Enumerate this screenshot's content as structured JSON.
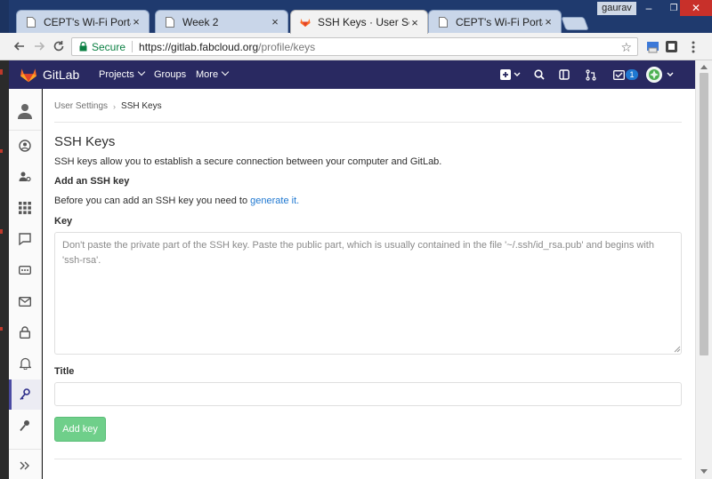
{
  "browser": {
    "tabs": [
      {
        "title": "CEPT's Wi-Fi Portal",
        "active": false
      },
      {
        "title": "Week 2",
        "active": false
      },
      {
        "title": "SSH Keys · User Settings",
        "active": true
      },
      {
        "title": "CEPT's Wi-Fi Portal",
        "active": false
      }
    ],
    "user_badge": "gaurav",
    "window_controls": [
      "–",
      "❐",
      "✕"
    ],
    "secure_label": "Secure",
    "url_host": "https://gitlab.fabcloud.org",
    "url_path": "/profile/keys"
  },
  "header": {
    "brand": "GitLab",
    "nav": [
      {
        "label": "Projects"
      },
      {
        "label": "Groups"
      },
      {
        "label": "More"
      }
    ],
    "todo_count": "1",
    "colors": {
      "background": "#292961",
      "accent": "#fc6d26"
    }
  },
  "sidebar": {
    "items": [
      {
        "icon": "profile-avatar-icon"
      },
      {
        "icon": "user-circle-icon"
      },
      {
        "icon": "account-icon"
      },
      {
        "icon": "applications-icon"
      },
      {
        "icon": "chat-icon"
      },
      {
        "icon": "tokens-icon"
      },
      {
        "icon": "emails-icon"
      },
      {
        "icon": "password-lock-icon"
      },
      {
        "icon": "notifications-bell-icon"
      },
      {
        "icon": "ssh-key-icon",
        "active": true
      },
      {
        "icon": "gpg-key-icon"
      },
      {
        "icon": "collapse-sidebar-icon"
      }
    ]
  },
  "breadcrumb": {
    "parent": "User Settings",
    "current": "SSH Keys"
  },
  "page": {
    "title": "SSH Keys",
    "description": "SSH keys allow you to establish a secure connection between your computer and GitLab.",
    "add_section_title": "Add an SSH key",
    "add_section_desc_prefix": "Before you can add an SSH key you need to ",
    "add_section_link": "generate it.",
    "key_label": "Key",
    "key_placeholder": "Don't paste the private part of the SSH key. Paste the public part, which is usually contained in the file '~/.ssh/id_rsa.pub' and begins with 'ssh-rsa'.",
    "title_label": "Title",
    "title_value": "",
    "add_button": "Add key",
    "button_color": "#6fcf8a"
  }
}
